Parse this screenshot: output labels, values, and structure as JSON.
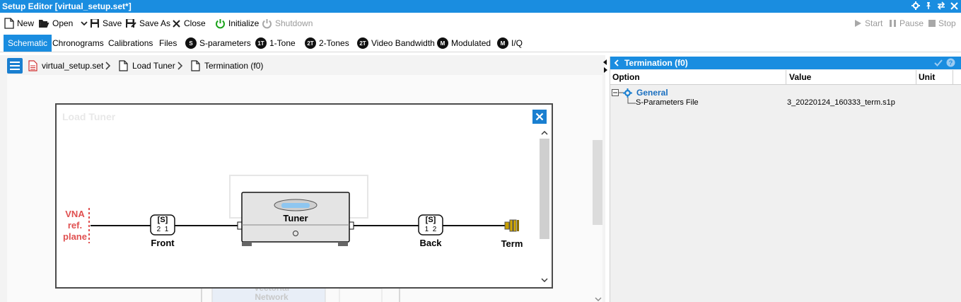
{
  "window": {
    "title": "Setup Editor [virtual_setup.set*]",
    "controls": [
      "gear-icon",
      "pin-icon",
      "swap-icon",
      "close-icon"
    ]
  },
  "toolbar": {
    "new_label": "New",
    "open_label": "Open",
    "save_label": "Save",
    "save_as_label": "Save As",
    "close_label": "Close",
    "initialize_label": "Initialize",
    "shutdown_label": "Shutdown",
    "start_label": "Start",
    "pause_label": "Pause",
    "stop_label": "Stop"
  },
  "tabs": [
    {
      "label": "Schematic",
      "badge": "",
      "active": true
    },
    {
      "label": "Chronograms",
      "badge": ""
    },
    {
      "label": "Calibrations",
      "badge": ""
    },
    {
      "label": "Files",
      "badge": ""
    },
    {
      "label": "S-parameters",
      "badge": "S"
    },
    {
      "label": "1-Tone",
      "badge": "1T"
    },
    {
      "label": "2-Tones",
      "badge": "2T"
    },
    {
      "label": "Video Bandwidth",
      "badge": "2T"
    },
    {
      "label": "Modulated",
      "badge": "M"
    },
    {
      "label": "I/Q",
      "badge": "M"
    }
  ],
  "breadcrumb": {
    "items": [
      "virtual_setup.set",
      "Load Tuner",
      "Termination (f0)"
    ]
  },
  "background_instrument": {
    "line1": "Vectorial",
    "line2": "Network"
  },
  "dialog": {
    "title": "Load Tuner",
    "ref_plane": [
      "VNA",
      "ref.",
      "plane"
    ],
    "front": {
      "label": "Front",
      "symbol": "[S]",
      "ports": "2  1"
    },
    "tuner": {
      "label": "Tuner"
    },
    "back": {
      "label": "Back",
      "symbol": "[S]",
      "ports": "1  2"
    },
    "term": {
      "label": "Term"
    }
  },
  "properties": {
    "title": "Termination (f0)",
    "columns": [
      "Option",
      "Value",
      "Unit"
    ],
    "group": "General",
    "rows": [
      {
        "option": "S-Parameters File",
        "value": "3_20220124_160333_term.s1p",
        "unit": ""
      }
    ]
  },
  "colors": {
    "accent": "#1a8de0",
    "ref_plane": "#e05050",
    "initialize_green": "#1aa31a"
  }
}
